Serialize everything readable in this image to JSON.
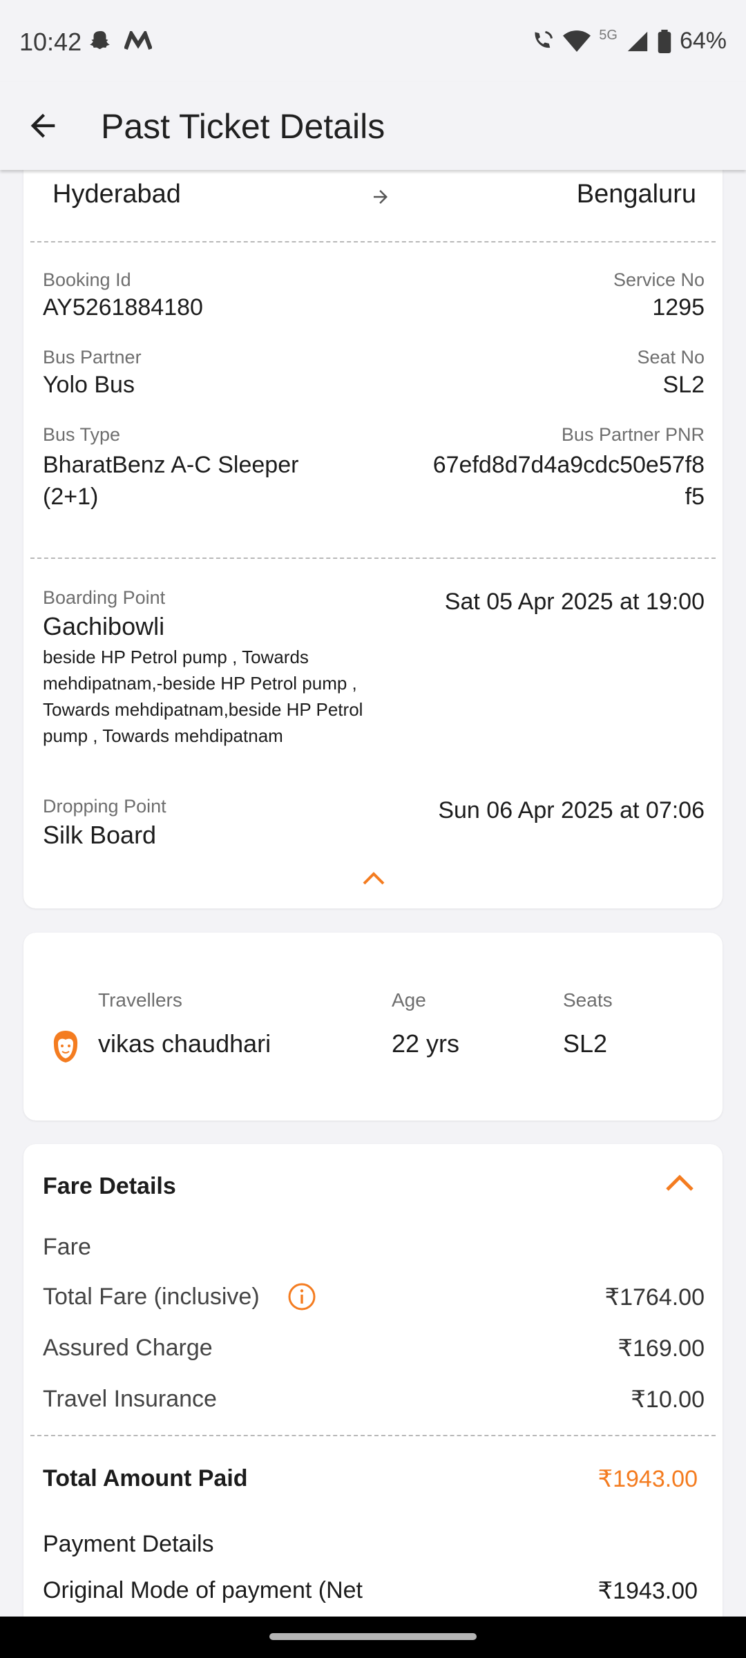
{
  "status_bar": {
    "time": "10:42",
    "network": "5G",
    "battery": "64%"
  },
  "app_bar": {
    "title": "Past Ticket Details"
  },
  "route": {
    "from": "Hyderabad",
    "to": "Bengaluru"
  },
  "booking": {
    "booking_id_label": "Booking Id",
    "booking_id": "AY5261884180",
    "service_no_label": "Service No",
    "service_no": "1295",
    "bus_partner_label": "Bus Partner",
    "bus_partner": "Yolo Bus",
    "seat_no_label": "Seat No",
    "seat_no": "SL2",
    "bus_type_label": "Bus Type",
    "bus_type_line1": "BharatBenz  A-C Sleeper",
    "bus_type_line2": "(2+1)",
    "pnr_label": "Bus Partner PNR",
    "pnr_line1": "67efd8d7d4a9cdc50e57f8",
    "pnr_line2": "f5"
  },
  "boarding": {
    "label": "Boarding Point",
    "name": "Gachibowli",
    "address": "beside HP Petrol pump , Towards mehdipatnam,-beside HP Petrol pump , Towards mehdipatnam,beside HP Petrol pump , Towards mehdipatnam",
    "datetime": "Sat 05 Apr 2025 at 19:00"
  },
  "dropping": {
    "label": "Dropping Point",
    "name": "Silk Board",
    "datetime": "Sun 06 Apr 2025 at 07:06"
  },
  "travellers": {
    "headers": {
      "name": "Travellers",
      "age": "Age",
      "seats": "Seats"
    },
    "rows": [
      {
        "name": "vikas chaudhari",
        "age": "22 yrs",
        "seat": "SL2"
      }
    ]
  },
  "fare": {
    "title": "Fare Details",
    "section_label": "Fare",
    "items": [
      {
        "label": "Total Fare (inclusive)",
        "value": "₹1764.00"
      },
      {
        "label": "Assured Charge",
        "value": "₹169.00"
      },
      {
        "label": "Travel Insurance",
        "value": "₹10.00"
      }
    ],
    "total_label": "Total Amount Paid",
    "total_value": "₹1943.00",
    "payment_title": "Payment Details",
    "payment_mode_label": "Original Mode of payment (Net",
    "payment_mode_value": "₹1943.00"
  },
  "colors": {
    "accent": "#f47c20",
    "background": "#f3f3f6"
  }
}
